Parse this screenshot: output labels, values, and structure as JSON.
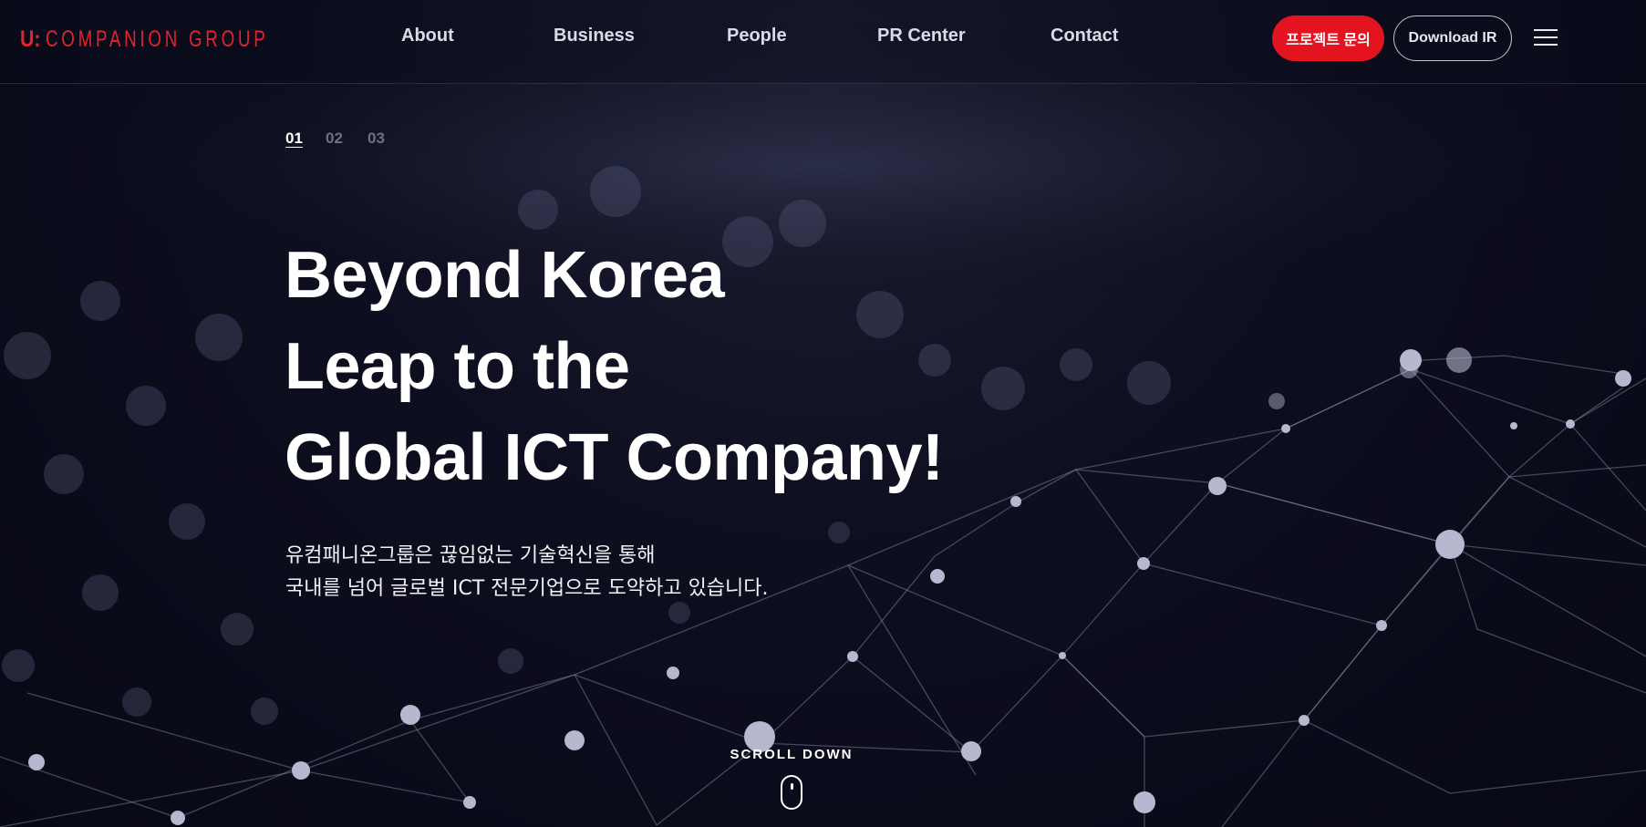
{
  "header": {
    "logo_mark": "U:",
    "logo_text": "COMPANION GROUP",
    "nav": [
      {
        "label": "About"
      },
      {
        "label": "Business"
      },
      {
        "label": "People"
      },
      {
        "label": "PR Center"
      },
      {
        "label": "Contact"
      }
    ],
    "inquiry_button": "프로젝트 문의",
    "ir_button": "Download IR",
    "menu_icon": "hamburger-menu-icon"
  },
  "slider": {
    "pages": [
      "01",
      "02",
      "03"
    ],
    "active": "01"
  },
  "hero": {
    "title_lines": [
      "Beyond Korea",
      "Leap to the",
      "Global ICT Company!"
    ],
    "description_lines": [
      "유컴패니온그룹은 끊임없는 기술혁신을 통해",
      "국내를 넘어 글로벌 ICT 전문기업으로 도약하고 있습니다."
    ]
  },
  "scroll": {
    "label": "SCROLL DOWN",
    "icon": "mouse-scroll-icon"
  },
  "colors": {
    "brand_red": "#e3141f",
    "background": "#0b0c1a",
    "nav_text": "#d9dbe6"
  }
}
